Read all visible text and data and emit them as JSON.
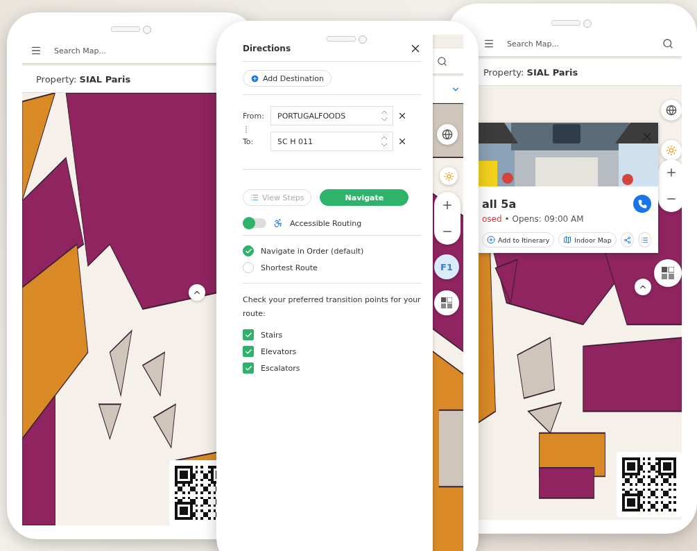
{
  "left_phone": {
    "search": {
      "placeholder": "Search Map..."
    },
    "property": {
      "label": "Property:",
      "value": "SIAL Paris"
    }
  },
  "directions_phone": {
    "title": "Directions",
    "add_destination": "Add Destination",
    "from": {
      "label": "From:",
      "value": "PORTUGALFOODS"
    },
    "to": {
      "label": "To:",
      "value": "5C H 011"
    },
    "view_steps": {
      "label": "View Steps",
      "disabled": true
    },
    "navigate": {
      "label": "Navigate"
    },
    "accessible_routing": {
      "label": "Accessible Routing",
      "on": false
    },
    "route_options": [
      {
        "label": "Navigate in Order (default)",
        "selected": true
      },
      {
        "label": "Shortest Route",
        "selected": false
      }
    ],
    "transition_prompt": "Check your preferred transition points for your route:",
    "transitions": [
      {
        "label": "Stairs",
        "checked": true
      },
      {
        "label": "Elevators",
        "checked": true
      },
      {
        "label": "Escalators",
        "checked": true
      }
    ],
    "floor_button": "F1"
  },
  "right_phone": {
    "search": {
      "placeholder": "Search Map..."
    },
    "property": {
      "label": "Property:",
      "value": "SIAL Paris"
    },
    "place_card": {
      "title": "all 5a",
      "status": "osed",
      "hours": "• Opens: 09:00 AM",
      "actions": [
        {
          "kind": "itinerary",
          "label": "Add to Itinerary"
        },
        {
          "kind": "indoor_map",
          "label": "Indoor Map"
        }
      ]
    }
  }
}
